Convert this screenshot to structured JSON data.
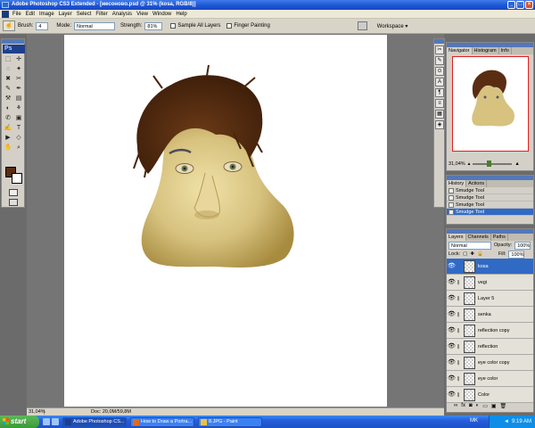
{
  "window": {
    "title": "Adobe Photoshop CS3 Extended - [жесоново.psd @ 31% (kosa, RGB/8)]",
    "controls": [
      "_",
      "□",
      "×"
    ]
  },
  "menubar": {
    "items": [
      "File",
      "Edit",
      "Image",
      "Layer",
      "Select",
      "Filter",
      "Analysis",
      "View",
      "Window",
      "Help"
    ],
    "mdi_controls": [
      "_",
      "□",
      "×"
    ]
  },
  "options_bar": {
    "brush_label": "Brush:",
    "brush_size": "4",
    "mode_label": "Mode:",
    "mode_value": "Normal",
    "strength_label": "Strength:",
    "strength_value": "81%",
    "sample_all_layers": "Sample All Layers",
    "finger_painting": "Finger Painting",
    "workspace": "Workspace ▾"
  },
  "toolbox": {
    "logo": "Ps",
    "tools": [
      "⬚",
      "✛",
      "◌",
      "✦",
      "✖",
      "✂",
      "✎",
      "✒",
      "⚒",
      "▤",
      "◐",
      "⚘",
      "✆",
      "▣",
      "✍",
      "T",
      "▶",
      "◇",
      "✋",
      "⌕"
    ],
    "fg_color": "#5a2d13",
    "bg_color": "#ffffff"
  },
  "document": {
    "zoom": "31,04%",
    "doc_info": "Doc: 20,0M/59,8M"
  },
  "navigator": {
    "tabs": [
      "Navigator",
      "Histogram",
      "Info"
    ],
    "zoom": "31,04%"
  },
  "history": {
    "tabs": [
      "History",
      "Actions"
    ],
    "items": [
      "Smudge Tool",
      "Smudge Tool",
      "Smudge Tool",
      "Smudge Tool"
    ],
    "selected_index": 3
  },
  "layers": {
    "tabs": [
      "Layers",
      "Channels",
      "Paths"
    ],
    "blend_mode": "Normal",
    "opacity_label": "Opacity:",
    "opacity_value": "100%",
    "lock_label": "Lock:",
    "fill_label": "Fill:",
    "fill_value": "100%",
    "items": [
      "kosa",
      "vegi",
      "Layer 5",
      "senka",
      "reflection copy",
      "reflection",
      "eye color copy",
      "eye color",
      "Color"
    ],
    "selected_index": 0
  },
  "taskbar": {
    "start": "start",
    "buttons": [
      "Adobe Photoshop CS...",
      "How to Draw a Portra...",
      "8.JPG - Paint"
    ],
    "lang": "MK",
    "time": "9:19 AM"
  }
}
